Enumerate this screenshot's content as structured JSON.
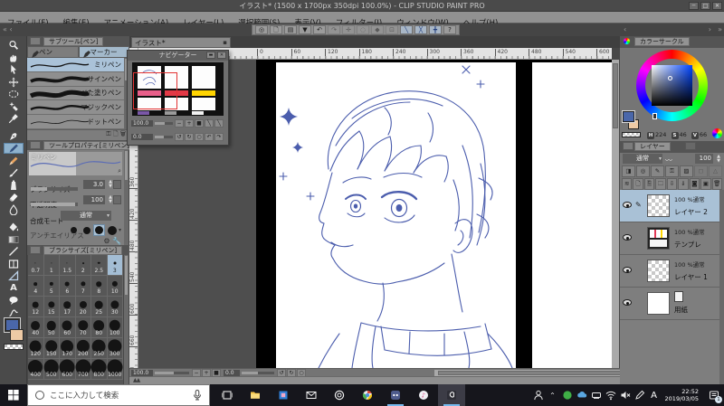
{
  "window": {
    "title": "イラスト* (1500 x 1700px 350dpi 100.0%) - CLIP STUDIO PAINT PRO"
  },
  "menubar": [
    "ファイル(F)",
    "編集(E)",
    "アニメーション(A)",
    "レイヤー(L)",
    "選択範囲(S)",
    "表示(V)",
    "フィルター(I)",
    "ウィンドウ(W)",
    "ヘルプ(H)"
  ],
  "toolbar_icons": [
    {
      "name": "clip-studio-logo-icon",
      "g": "◎"
    },
    {
      "name": "new-file-icon",
      "g": "🗋"
    },
    {
      "name": "open-file-icon",
      "g": "▤"
    },
    {
      "name": "save-file-icon",
      "g": "▼"
    },
    {
      "name": "undo-icon",
      "g": "↶"
    },
    {
      "name": "redo-icon",
      "g": "↷",
      "dim": true
    },
    {
      "name": "deselect-icon",
      "g": "✛",
      "dim": true
    },
    {
      "name": "clear-selection-icon",
      "g": "◌",
      "dim": true
    },
    {
      "name": "fill-icon",
      "g": "◆",
      "dim": true
    },
    {
      "name": "transform-icon",
      "g": "⊡",
      "dim": true
    },
    {
      "name": "snap-ruler-icon",
      "g": "╲",
      "blue": true
    },
    {
      "name": "snap-special-ruler-icon",
      "g": "╳",
      "blue": true
    },
    {
      "name": "snap-grid-icon",
      "g": "╋",
      "blue": true
    },
    {
      "name": "help-icon",
      "g": "?"
    }
  ],
  "tools": [
    {
      "name": "zoom-tool"
    },
    {
      "name": "move-tool"
    },
    {
      "name": "operation-tool"
    },
    {
      "name": "layer-move-tool"
    },
    {
      "name": "selection-tool"
    },
    {
      "name": "auto-select-tool"
    },
    {
      "name": "eyedropper-tool"
    },
    {
      "name": "pen-tool"
    },
    {
      "name": "marker-tool",
      "selected": true
    },
    {
      "name": "pencil-tool"
    },
    {
      "name": "brush-tool"
    },
    {
      "name": "airbrush-tool"
    },
    {
      "name": "eraser-tool"
    },
    {
      "name": "blend-tool"
    },
    {
      "name": "fill-tool"
    },
    {
      "name": "gradient-tool"
    },
    {
      "name": "line-tool"
    },
    {
      "name": "frame-tool"
    },
    {
      "name": "ruler-tool"
    },
    {
      "name": "text-tool"
    },
    {
      "name": "balloon-tool"
    },
    {
      "name": "stream-line-tool"
    }
  ],
  "subtool": {
    "header": "サブツール[ペン]",
    "tabs": [
      {
        "label": "ペン",
        "active": false
      },
      {
        "label": "マーカー",
        "active": true
      }
    ],
    "items": [
      {
        "name": "ミリペン",
        "weight": 1.3,
        "selected": true
      },
      {
        "name": "サインペン",
        "weight": 3.6,
        "selected": false
      },
      {
        "name": "べた塗りペン",
        "weight": 5.0,
        "selected": false
      },
      {
        "name": "マジックペン",
        "weight": 2.4,
        "selected": false
      },
      {
        "name": "ドットペン",
        "weight": 0.8,
        "selected": false
      }
    ]
  },
  "tool_property": {
    "header": "ツールプロパティ[ミリペン]",
    "tool_name": "ミリペン",
    "sliders": [
      {
        "label": "ブラシサイズ",
        "value": "3.0",
        "fill": 0.35
      },
      {
        "label": "不透明度",
        "value": "100",
        "fill": 0.95
      }
    ],
    "dropdown_label": "合成モード",
    "dropdown_value": "通常",
    "aa_label": "アンチエイリアス"
  },
  "brush_size": {
    "header": "ブラシサイズ[ミリペン]",
    "selected": "3",
    "sizes": [
      "0.7",
      "1",
      "1.5",
      "2",
      "2.5",
      "3",
      "4",
      "5",
      "6",
      "7",
      "8",
      "10",
      "12",
      "15",
      "17",
      "20",
      "25",
      "30",
      "40",
      "50",
      "60",
      "70",
      "80",
      "100",
      "120",
      "150",
      "170",
      "200",
      "250",
      "300",
      "400",
      "500",
      "600",
      "700",
      "800",
      "1000"
    ]
  },
  "navigator": {
    "title": "ナビゲーター",
    "zoom": "100.0",
    "angle": "0.0"
  },
  "canvas": {
    "tab": "イラスト*",
    "zoom": "100.0",
    "angle": "0.0",
    "h_ruler": [
      "0",
      "60",
      "120",
      "180",
      "240",
      "300",
      "360",
      "420",
      "480",
      "540",
      "600"
    ],
    "v_ruler": [
      "360",
      "420",
      "480",
      "540",
      "600",
      "660",
      "720"
    ],
    "sketch_color": "#4b5dad"
  },
  "color_wheel": {
    "header": "カラーサークル",
    "h_label": "H",
    "h": "224",
    "s_label": "S",
    "s": "46",
    "v_label": "V",
    "v": "66",
    "foreground": "#4a67aa",
    "background": "#eecaa5"
  },
  "layers": {
    "header": "レイヤー",
    "blend": "通常",
    "opacity": "100",
    "items": [
      {
        "thumb": "checker",
        "meta": "100 %通常",
        "name": "レイヤー 2",
        "selected": true,
        "editing": true
      },
      {
        "thumb": "template",
        "meta": "100 %通常",
        "name": "テンプレ",
        "selected": false,
        "editing": false
      },
      {
        "thumb": "checker",
        "meta": "100 %通常",
        "name": "レイヤー 1",
        "selected": false,
        "editing": false
      },
      {
        "thumb": "paper",
        "meta": "",
        "name": "用紙",
        "selected": false,
        "editing": false
      }
    ]
  },
  "taskbar": {
    "search_placeholder": "ここに入力して検索",
    "apps": [
      {
        "name": "task-view-icon"
      },
      {
        "name": "file-explorer-icon"
      },
      {
        "name": "photos-icon"
      },
      {
        "name": "mail-icon"
      },
      {
        "name": "clip-studio-icon"
      },
      {
        "name": "chrome-icon"
      },
      {
        "name": "discord-icon",
        "running": true
      },
      {
        "name": "itunes-icon"
      },
      {
        "name": "clip-studio-paint-icon",
        "running": true,
        "active": true
      }
    ],
    "tray": [
      {
        "name": "people-icon"
      },
      {
        "name": "hidden-icons-chevron"
      },
      {
        "name": "status-green-icon"
      },
      {
        "name": "cloud-sync-icon"
      },
      {
        "name": "device-icon"
      },
      {
        "name": "wifi-icon"
      },
      {
        "name": "volume-muted-icon"
      },
      {
        "name": "pen-input-icon"
      },
      {
        "name": "ime-mode-a"
      }
    ],
    "time": "22:52",
    "date": "2019/03/05",
    "notification_badge": "1"
  }
}
